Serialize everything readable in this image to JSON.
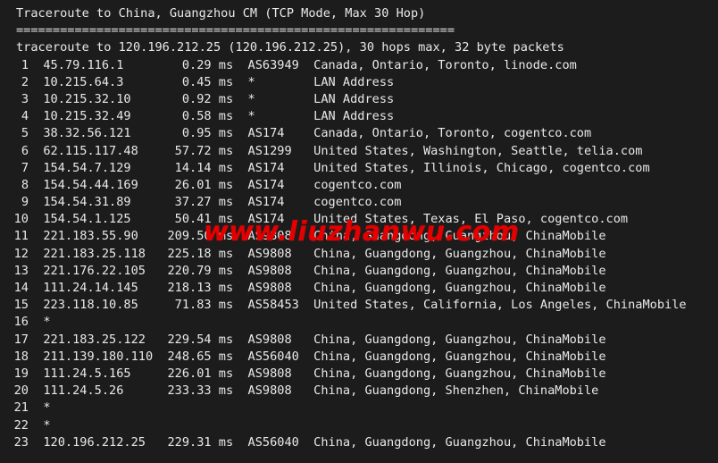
{
  "terminal": {
    "background_color": "#1c1c1c",
    "text_color": "#e9e9e9",
    "title": "Traceroute to China, Guangzhou CM (TCP Mode, Max 30 Hop)",
    "separator": "============================================================",
    "summary": "traceroute to 120.196.212.25 (120.196.212.25), 30 hops max, 32 byte packets"
  },
  "watermark": {
    "text": "www.liuzhanwu.com",
    "color": "#e40000"
  },
  "hops": [
    {
      "num": "1",
      "ip": "45.79.116.1",
      "rtt": "0.29 ms",
      "asn": "AS63949",
      "geo": "Canada, Ontario, Toronto, linode.com"
    },
    {
      "num": "2",
      "ip": "10.215.64.3",
      "rtt": "0.45 ms",
      "asn": "*",
      "geo": "LAN Address"
    },
    {
      "num": "3",
      "ip": "10.215.32.10",
      "rtt": "0.92 ms",
      "asn": "*",
      "geo": "LAN Address"
    },
    {
      "num": "4",
      "ip": "10.215.32.49",
      "rtt": "0.58 ms",
      "asn": "*",
      "geo": "LAN Address"
    },
    {
      "num": "5",
      "ip": "38.32.56.121",
      "rtt": "0.95 ms",
      "asn": "AS174",
      "geo": "Canada, Ontario, Toronto, cogentco.com"
    },
    {
      "num": "6",
      "ip": "62.115.117.48",
      "rtt": "57.72 ms",
      "asn": "AS1299",
      "geo": "United States, Washington, Seattle, telia.com"
    },
    {
      "num": "7",
      "ip": "154.54.7.129",
      "rtt": "14.14 ms",
      "asn": "AS174",
      "geo": "United States, Illinois, Chicago, cogentco.com"
    },
    {
      "num": "8",
      "ip": "154.54.44.169",
      "rtt": "26.01 ms",
      "asn": "AS174",
      "geo": "cogentco.com"
    },
    {
      "num": "9",
      "ip": "154.54.31.89",
      "rtt": "37.27 ms",
      "asn": "AS174",
      "geo": "cogentco.com"
    },
    {
      "num": "10",
      "ip": "154.54.1.125",
      "rtt": "50.41 ms",
      "asn": "AS174",
      "geo": "United States, Texas, El Paso, cogentco.com"
    },
    {
      "num": "11",
      "ip": "221.183.55.90",
      "rtt": "209.50 ms",
      "asn": "AS9808",
      "geo": "China, Guangdong, Guangzhou, ChinaMobile"
    },
    {
      "num": "12",
      "ip": "221.183.25.118",
      "rtt": "225.18 ms",
      "asn": "AS9808",
      "geo": "China, Guangdong, Guangzhou, ChinaMobile"
    },
    {
      "num": "13",
      "ip": "221.176.22.105",
      "rtt": "220.79 ms",
      "asn": "AS9808",
      "geo": "China, Guangdong, Guangzhou, ChinaMobile"
    },
    {
      "num": "14",
      "ip": "111.24.14.145",
      "rtt": "218.13 ms",
      "asn": "AS9808",
      "geo": "China, Guangdong, Guangzhou, ChinaMobile"
    },
    {
      "num": "15",
      "ip": "223.118.10.85",
      "rtt": "71.83 ms",
      "asn": "AS58453",
      "geo": "United States, California, Los Angeles, ChinaMobile"
    },
    {
      "num": "16",
      "ip": "*",
      "rtt": "",
      "asn": "",
      "geo": ""
    },
    {
      "num": "17",
      "ip": "221.183.25.122",
      "rtt": "229.54 ms",
      "asn": "AS9808",
      "geo": "China, Guangdong, Guangzhou, ChinaMobile"
    },
    {
      "num": "18",
      "ip": "211.139.180.110",
      "rtt": "248.65 ms",
      "asn": "AS56040",
      "geo": "China, Guangdong, Guangzhou, ChinaMobile"
    },
    {
      "num": "19",
      "ip": "111.24.5.165",
      "rtt": "226.01 ms",
      "asn": "AS9808",
      "geo": "China, Guangdong, Guangzhou, ChinaMobile"
    },
    {
      "num": "20",
      "ip": "111.24.5.26",
      "rtt": "233.33 ms",
      "asn": "AS9808",
      "geo": "China, Guangdong, Shenzhen, ChinaMobile"
    },
    {
      "num": "21",
      "ip": "*",
      "rtt": "",
      "asn": "",
      "geo": ""
    },
    {
      "num": "22",
      "ip": "*",
      "rtt": "",
      "asn": "",
      "geo": ""
    },
    {
      "num": "23",
      "ip": "120.196.212.25",
      "rtt": "229.31 ms",
      "asn": "AS56040",
      "geo": "China, Guangdong, Guangzhou, ChinaMobile"
    }
  ]
}
